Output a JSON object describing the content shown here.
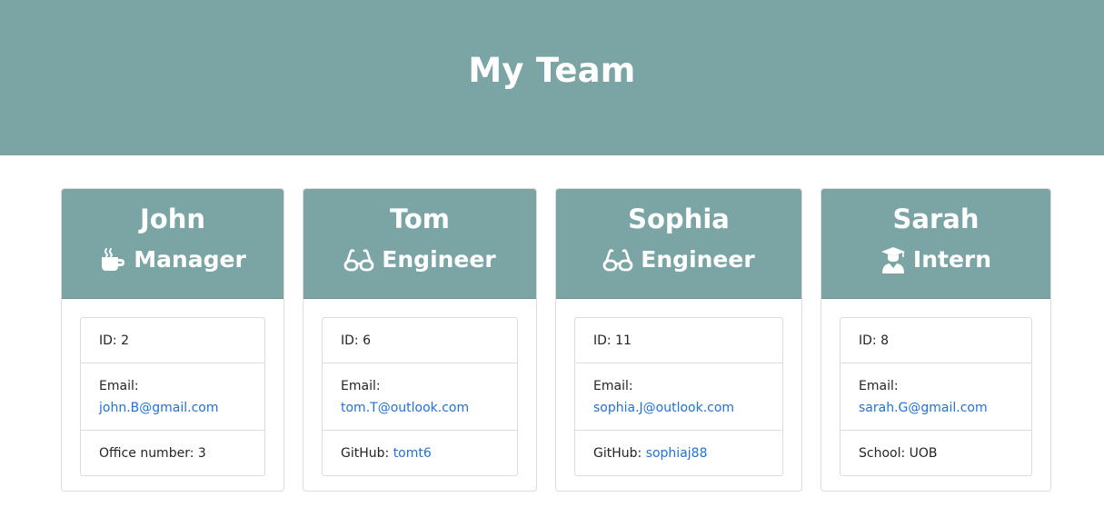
{
  "header": {
    "title": "My Team"
  },
  "employees": [
    {
      "name": "John",
      "role": "Manager",
      "icon": "coffee-icon",
      "id_label": "ID:",
      "id": "2",
      "email_label": "Email:",
      "email": "john.B@gmail.com",
      "extra_label": "Office number:",
      "extra_value": "3"
    },
    {
      "name": "Tom",
      "role": "Engineer",
      "icon": "glasses-icon",
      "id_label": "ID:",
      "id": "6",
      "email_label": "Email:",
      "email": "tom.T@outlook.com",
      "extra_label": "GitHub:",
      "extra_value": "tomt6"
    },
    {
      "name": "Sophia",
      "role": "Engineer",
      "icon": "glasses-icon",
      "id_label": "ID:",
      "id": "11",
      "email_label": "Email:",
      "email": "sophia.J@outlook.com",
      "extra_label": "GitHub:",
      "extra_value": "sophiaj88"
    },
    {
      "name": "Sarah",
      "role": "Intern",
      "icon": "graduate-icon",
      "id_label": "ID:",
      "id": "8",
      "email_label": "Email:",
      "email": "sarah.G@gmail.com",
      "extra_label": "School:",
      "extra_value": "UOB"
    }
  ],
  "colors": {
    "header_bg": "#7ba5a4",
    "link": "#1f72d6",
    "text": "#212529",
    "border": "#dcdcdc"
  }
}
